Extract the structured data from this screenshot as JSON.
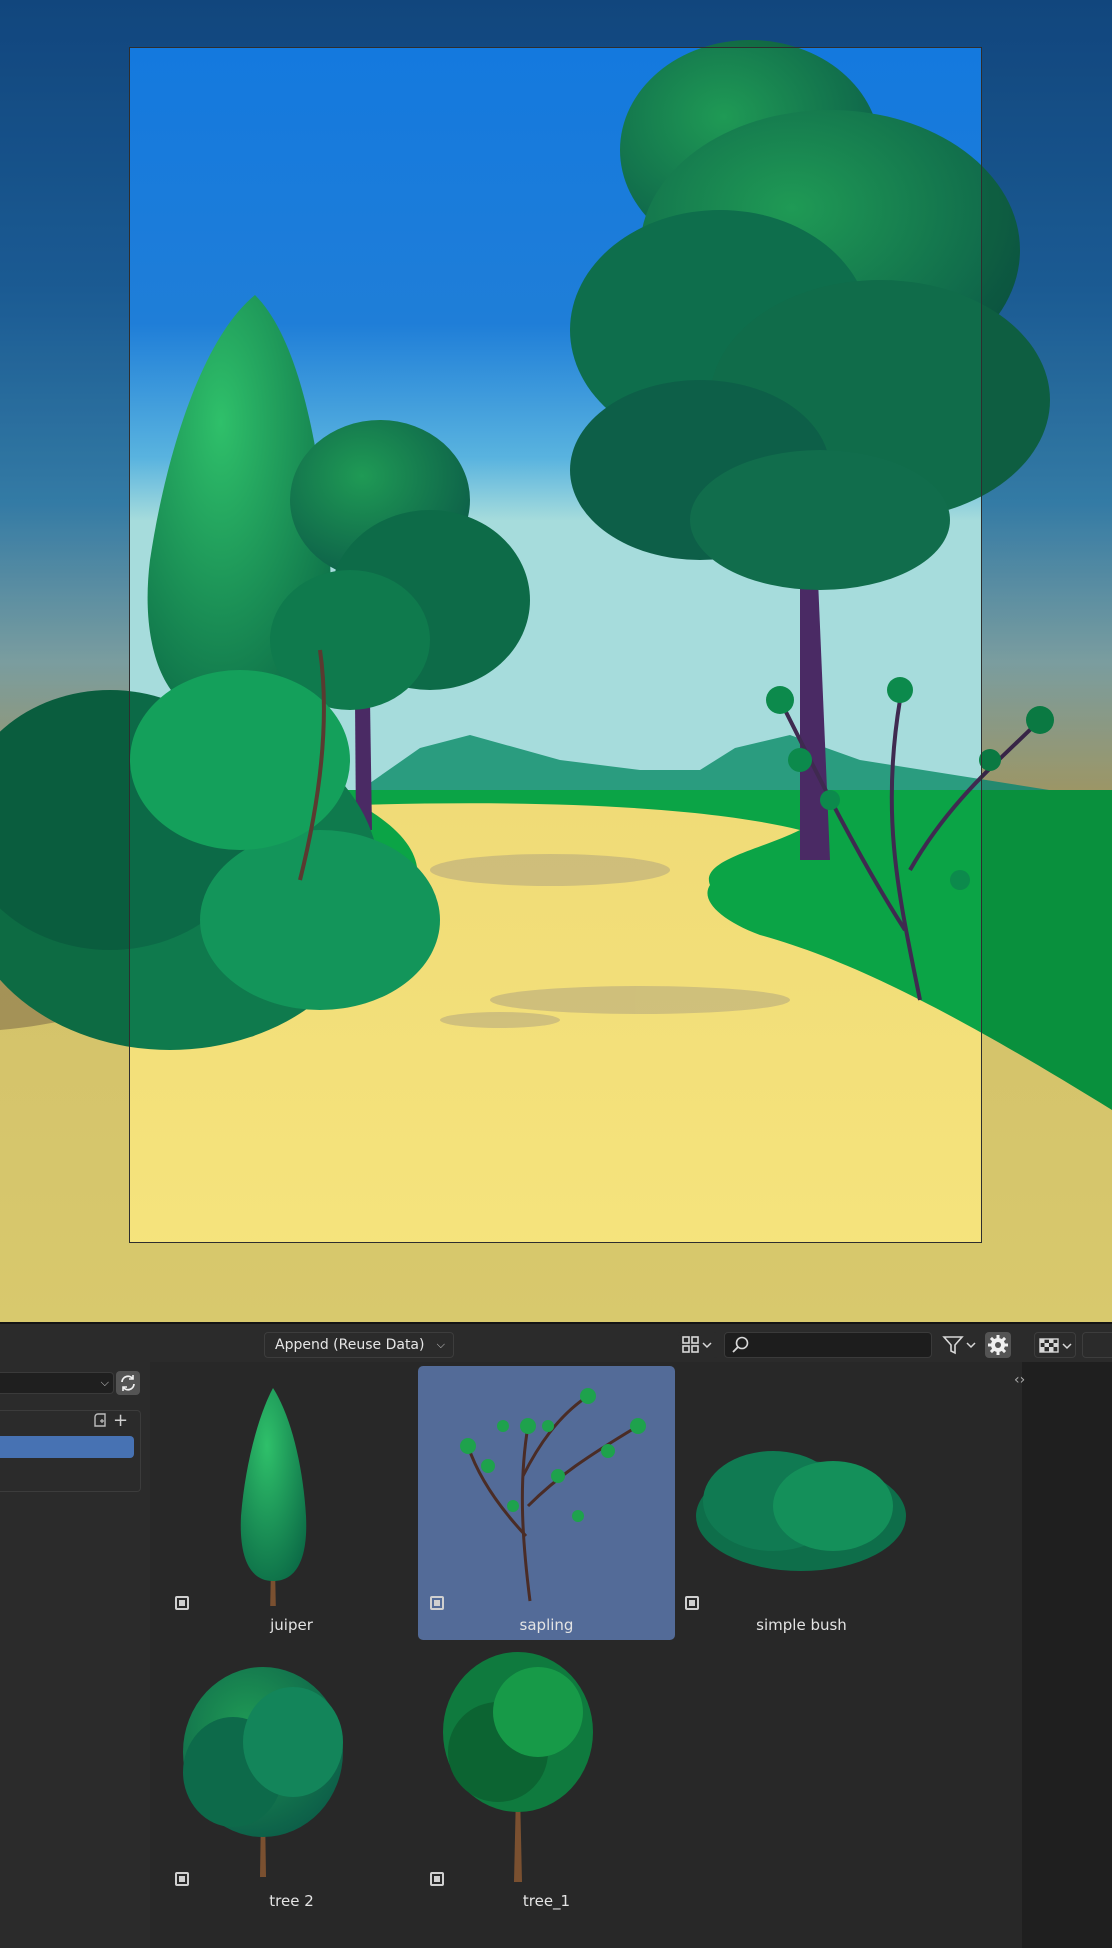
{
  "browser": {
    "import_method": "Append (Reuse Data)",
    "search_placeholder": "",
    "assets": [
      {
        "name": "juiper",
        "selected": false,
        "icon": "object-asset-icon"
      },
      {
        "name": "sapling",
        "selected": true,
        "icon": "object-asset-icon"
      },
      {
        "name": "simple bush",
        "selected": false,
        "icon": "object-asset-icon"
      },
      {
        "name": "tree 2",
        "selected": false,
        "icon": "object-asset-icon"
      },
      {
        "name": "tree_1",
        "selected": false,
        "icon": "object-asset-icon"
      }
    ]
  },
  "icons": {
    "display_mode": "grid-icon",
    "search": "search-icon",
    "filter": "funnel-icon",
    "settings": "gear-icon",
    "shading": "checker-icon",
    "refresh": "refresh-icon",
    "collapse": "chevron-left-right-icon"
  },
  "colors": {
    "selection": "#536b98",
    "catalog_highlight": "#4772b3",
    "sky_top": "#1a7ee0",
    "path": "#f4e07a",
    "grass": "#08a343"
  }
}
